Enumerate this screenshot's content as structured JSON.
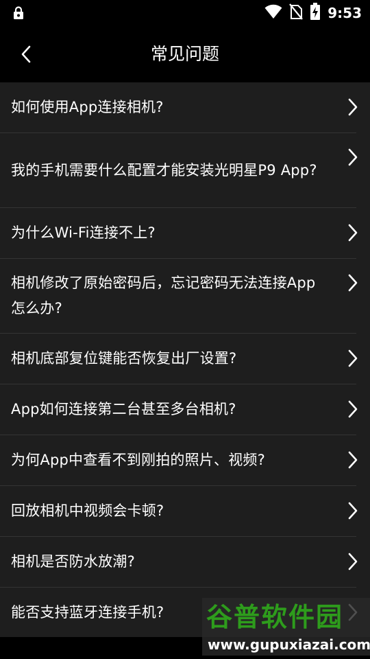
{
  "status_bar": {
    "time": "9:53",
    "icons": [
      "lock-icon",
      "wifi-icon",
      "no-sim-icon",
      "battery-charging-icon"
    ]
  },
  "app_bar": {
    "back_icon": "chevron-left-icon",
    "title": "常见问题"
  },
  "faq": {
    "items": [
      {
        "text": "如何使用App连接相机?"
      },
      {
        "text": "我的手机需要什么配置才能安装光明星P9 App?"
      },
      {
        "text": "为什么Wi-Fi连接不上?"
      },
      {
        "text": "相机修改了原始密码后，忘记密码无法连接App怎么办?"
      },
      {
        "text": "相机底部复位键能否恢复出厂设置?"
      },
      {
        "text": "App如何连接第二台甚至多台相机?"
      },
      {
        "text": "为何App中查看不到刚拍的照片、视频?"
      },
      {
        "text": "回放相机中视频会卡顿?"
      },
      {
        "text": "相机是否防水放潮?"
      },
      {
        "text": "能否支持蓝牙连接手机?"
      }
    ],
    "chevron_icon": "chevron-right-icon"
  },
  "watermark": {
    "title": "谷普软件园",
    "url": "www.gupuxiazai.com"
  },
  "colors": {
    "background": "#000000",
    "list_background": "#1e1e1e",
    "divider": "#343434",
    "text": "#ffffff",
    "watermark_green": "#2e9c1c"
  }
}
